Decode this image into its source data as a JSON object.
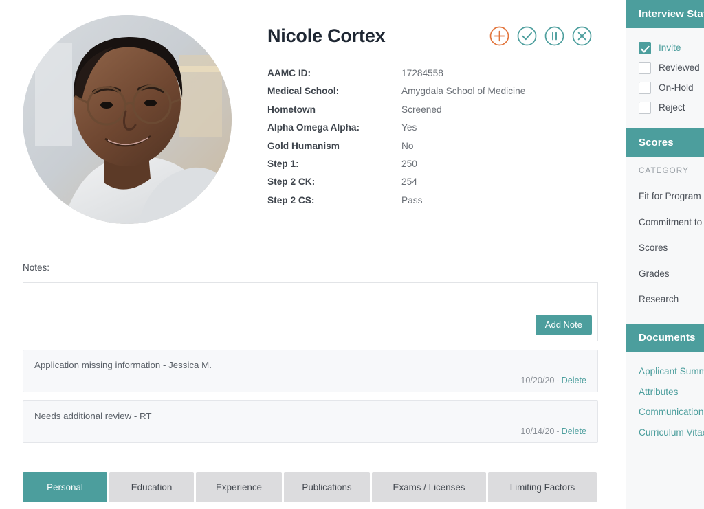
{
  "profile": {
    "name": "Nicole Cortex",
    "avatar_alt": "applicant-portrait",
    "actions": [
      {
        "name": "add-icon",
        "label": "Add",
        "color": "#e2743b"
      },
      {
        "name": "check-icon",
        "label": "Accept",
        "color": "#4c9e9d"
      },
      {
        "name": "pause-icon",
        "label": "Hold",
        "color": "#4c9e9d"
      },
      {
        "name": "close-icon",
        "label": "Reject",
        "color": "#4c9e9d"
      }
    ],
    "details": [
      {
        "label": "AAMC ID:",
        "value": "17284558"
      },
      {
        "label": "Medical School:",
        "value": "Amygdala School of Medicine"
      },
      {
        "label": "Hometown",
        "value": "Screened"
      },
      {
        "label": "Alpha Omega Alpha:",
        "value": "Yes"
      },
      {
        "label": "Gold Humanism",
        "value": "No"
      },
      {
        "label": "Step 1:",
        "value": "250"
      },
      {
        "label": "Step 2 CK:",
        "value": "254"
      },
      {
        "label": "Step 2 CS:",
        "value": "Pass"
      }
    ]
  },
  "notes": {
    "label": "Notes:",
    "input_value": "",
    "input_placeholder": "",
    "add_button": "Add Note",
    "separator": "-",
    "delete_label": "Delete",
    "items": [
      {
        "text": "Application missing information - Jessica M.",
        "date": "10/20/20"
      },
      {
        "text": "Needs additional review - RT",
        "date": "10/14/20"
      }
    ]
  },
  "tabs": [
    {
      "label": "Personal",
      "active": true
    },
    {
      "label": "Education",
      "active": false
    },
    {
      "label": "Experience",
      "active": false
    },
    {
      "label": "Publications",
      "active": false
    },
    {
      "label": "Exams / Licenses",
      "active": false
    },
    {
      "label": "Limiting Factors",
      "active": false
    }
  ],
  "sidebar": {
    "interview_status": {
      "title": "Interview Status",
      "options": [
        {
          "label": "Invite",
          "checked": true
        },
        {
          "label": "Reviewed",
          "checked": false
        },
        {
          "label": "On-Hold",
          "checked": false
        },
        {
          "label": "Reject",
          "checked": false
        }
      ]
    },
    "scores": {
      "title": "Scores",
      "column_header": "CATEGORY",
      "rows": [
        {
          "label": "Fit for Program"
        },
        {
          "label": "Commitment to"
        },
        {
          "label": "Scores"
        },
        {
          "label": "Grades"
        },
        {
          "label": "Research"
        }
      ]
    },
    "documents": {
      "title": "Documents",
      "links": [
        {
          "label": "Applicant Summary"
        },
        {
          "label": "Attributes"
        },
        {
          "label": "Communications"
        },
        {
          "label": "Curriculum Vitae"
        }
      ]
    }
  },
  "colors": {
    "teal": "#4c9e9d",
    "orange": "#e2743b",
    "tab_inactive": "#dcdcde",
    "sidebar_bg": "#f7f8f9",
    "note_bg": "#f7f8fa"
  }
}
